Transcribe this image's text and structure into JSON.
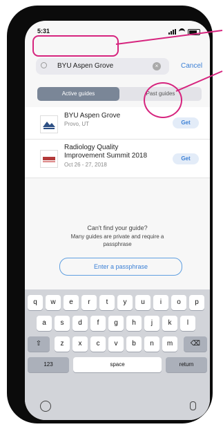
{
  "status": {
    "time": "5:31"
  },
  "search": {
    "value": "BYU Aspen Grove",
    "cancel": "Cancel"
  },
  "tabs": [
    "Active guides",
    "Past guides"
  ],
  "results": [
    {
      "title": "BYU Aspen Grove",
      "subtitle": "Provo, UT",
      "action": "Get"
    },
    {
      "title_line1": "Radiology Quality",
      "title_line2": "Improvement Summit 2018",
      "subtitle": "Oct 26 - 27, 2018",
      "action": "Get"
    }
  ],
  "cant_find": {
    "question": "Can't find your guide?",
    "message_line1": "Many guides are private and require a",
    "message_line2": "passphrase",
    "button": "Enter a passphrase"
  },
  "keyboard": {
    "row1": [
      "q",
      "w",
      "e",
      "r",
      "t",
      "y",
      "u",
      "i",
      "o",
      "p"
    ],
    "row2": [
      "a",
      "s",
      "d",
      "f",
      "g",
      "h",
      "j",
      "k",
      "l"
    ],
    "row3": [
      "z",
      "x",
      "c",
      "v",
      "b",
      "n",
      "m"
    ],
    "numbers": "123",
    "space": "space",
    "return": "return"
  },
  "colors": {
    "highlight": "#d6247e",
    "accent": "#3a7fd5"
  }
}
